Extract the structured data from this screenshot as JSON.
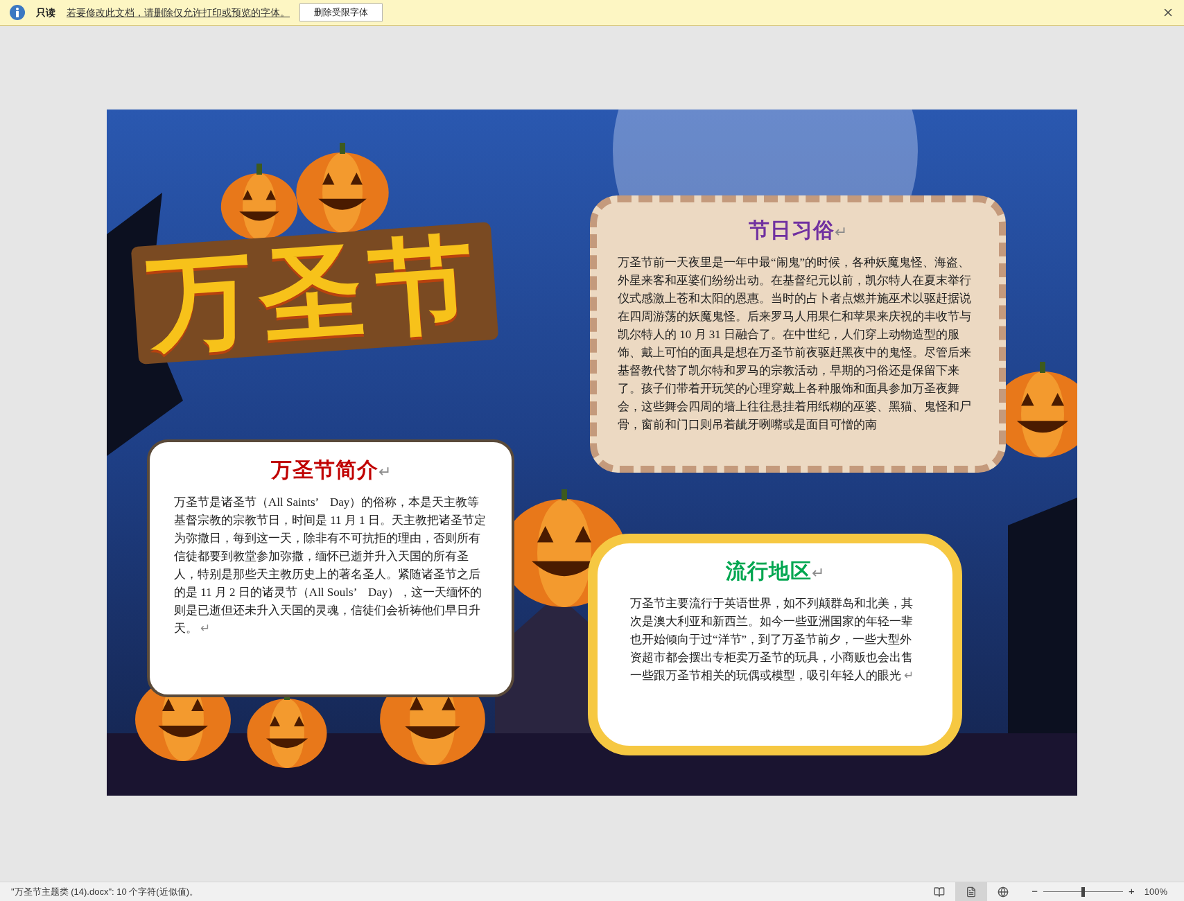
{
  "infobar": {
    "label": "只读",
    "message": "若要修改此文档，请删除仅允许打印或预览的字体。",
    "button": "删除受限字体"
  },
  "poster": {
    "title": "万圣节",
    "panels": [
      {
        "kind": "customs",
        "title": "节日习俗",
        "color": "#7030a0",
        "title_mark": "↵",
        "text": "万圣节前一天夜里是一年中最“闹鬼”的时候，各种妖魔鬼怪、海盗、外星来客和巫婆们纷纷出动。在基督纪元以前，凯尔特人在夏末举行仪式感激上苍和太阳的恩惠。当时的占卜者点燃并施巫术以驱赶据说在四周游荡的妖魔鬼怪。后来罗马人用果仁和苹果来庆祝的丰收节与凯尔特人的 10 月 31 日融合了。在中世纪，人们穿上动物造型的服饰、戴上可怕的面具是想在万圣节前夜驱赶黑夜中的鬼怪。尽管后来基督教代替了凯尔特和罗马的宗教活动，早期的习俗还是保留下来了。孩子们带着开玩笑的心理穿戴上各种服饰和面具参加万圣夜舞会，这些舞会四周的墙上往往悬挂着用纸糊的巫婆、黑猫、鬼怪和尸骨，窗前和门口则吊着龇牙咧嘴或是面目可憎的南"
      },
      {
        "kind": "intro",
        "title": "万圣节简介",
        "color": "#c00000",
        "title_mark": "↵",
        "text": "万圣节是诸圣节（All Saints’　Day）的俗称，本是天主教等基督宗教的宗教节日，时间是 11 月 1 日。天主教把诸圣节定为弥撒日，每到这一天，除非有不可抗拒的理由，否则所有信徒都要到教堂参加弥撒，缅怀已逝并升入天国的所有圣人，特别是那些天主教历史上的著名圣人。紧随诸圣节之后的是 11 月 2 日的诸灵节（All Souls’　Day），这一天缅怀的则是已逝但还未升入天国的灵魂，信徒们会祈祷他们早日升天。",
        "end_mark": "↵"
      },
      {
        "kind": "region",
        "title": "流行地区",
        "color": "#00a650",
        "title_mark": "↵",
        "text": "万圣节主要流行于英语世界，如不列颠群岛和北美，其次是澳大利亚和新西兰。如今一些亚洲国家的年轻一辈也开始倾向于过“洋节”，到了万圣节前夕，一些大型外资超市都会摆出专柜卖万圣节的玩具，小商贩也会出售一些跟万圣节相关的玩偶或模型，吸引年轻人的眼光",
        "end_mark": "↵"
      }
    ]
  },
  "status_bar": {
    "text": "\"万圣节主题类 (14).docx\": 10 个字符(近似值)。",
    "views": [
      {
        "kind": "read",
        "selected": false
      },
      {
        "kind": "print",
        "selected": true
      },
      {
        "kind": "web",
        "selected": false
      }
    ],
    "zoom": {
      "minus": "−",
      "plus": "+",
      "level": 0.5,
      "reading": "100%"
    }
  }
}
